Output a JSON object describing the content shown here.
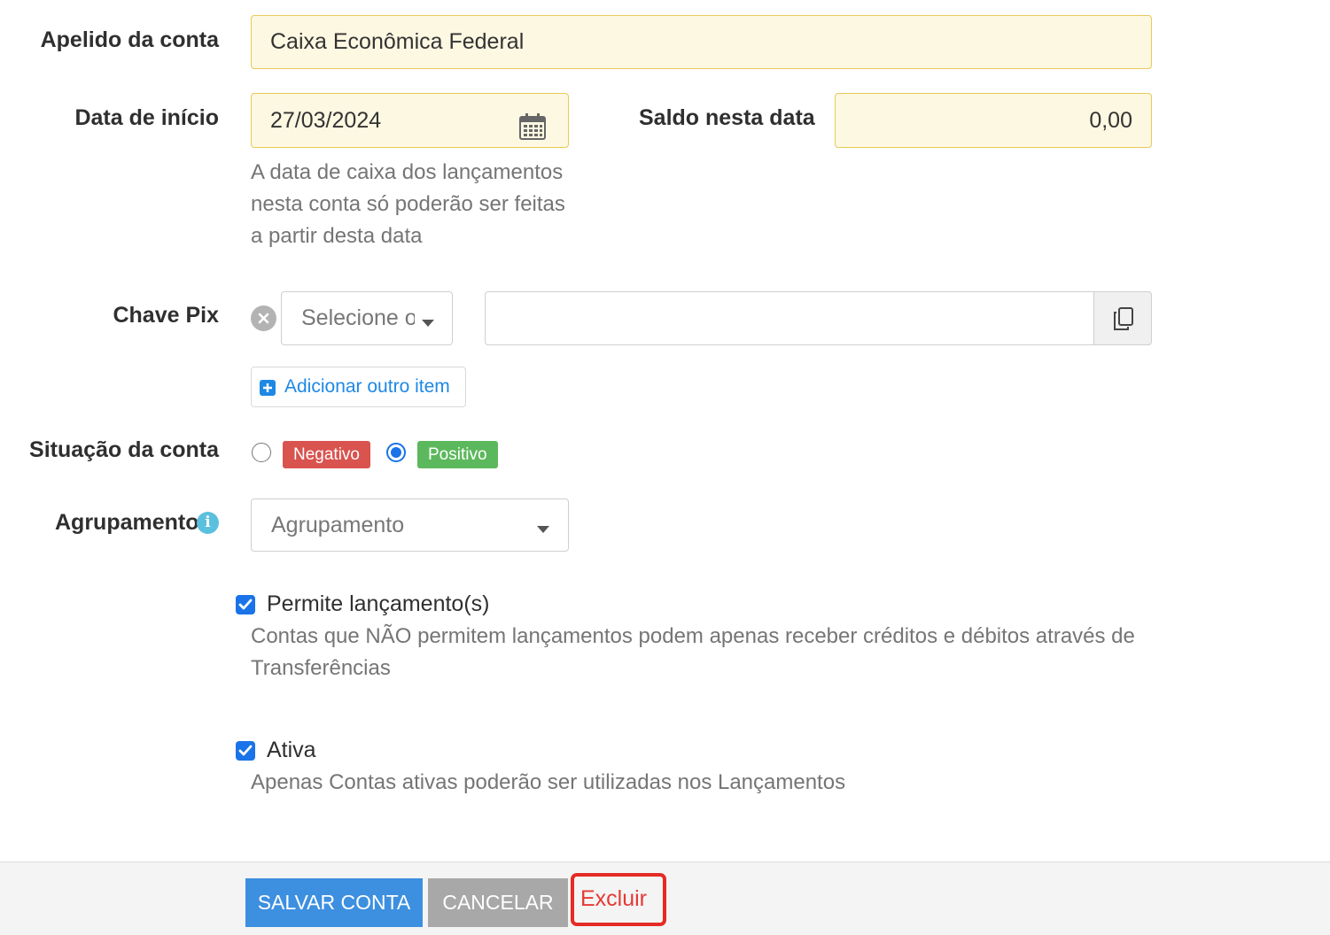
{
  "fields": {
    "nickname": {
      "label": "Apelido da conta",
      "value": "Caixa Econômica Federal"
    },
    "start_date": {
      "label": "Data de início",
      "value": "27/03/2024",
      "help": [
        "A data de caixa dos lançamentos",
        "nesta conta só poderão ser feitas",
        "a partir desta data"
      ]
    },
    "balance": {
      "label": "Saldo nesta data",
      "value": "0,00"
    },
    "pix": {
      "label": "Chave Pix",
      "type_placeholder": "Selecione o t",
      "key_value": "",
      "add_item_label": "Adicionar outro item"
    },
    "status": {
      "label": "Situação da conta",
      "options": [
        {
          "label": "Negativo",
          "color": "#d9534f",
          "selected": false
        },
        {
          "label": "Positivo",
          "color": "#5cb85c",
          "selected": true
        }
      ]
    },
    "grouping": {
      "label": "Agrupamento",
      "placeholder": "Agrupamento"
    },
    "allow_entries": {
      "label": "Permite lançamento(s)",
      "checked": true,
      "help": [
        "Contas que NÃO permitem lançamentos podem apenas receber créditos e débitos através de",
        "Transferências"
      ]
    },
    "active": {
      "label": "Ativa",
      "checked": true,
      "help": "Apenas Contas ativas poderão ser utilizadas nos Lançamentos"
    }
  },
  "actions": {
    "save_label": "SALVAR CONTA",
    "cancel_label": "CANCELAR",
    "delete_label": "Excluir"
  },
  "colors": {
    "primary": "#3d8fe0",
    "cancel": "#a8a8a8",
    "danger": "#e53935",
    "link": "#1e88e5",
    "info": "#5bc0de"
  },
  "icons": [
    "calendar-icon",
    "clear-icon",
    "chevron-down-icon",
    "copy-icon",
    "plus-square-icon",
    "info-icon",
    "checkmark-icon"
  ]
}
